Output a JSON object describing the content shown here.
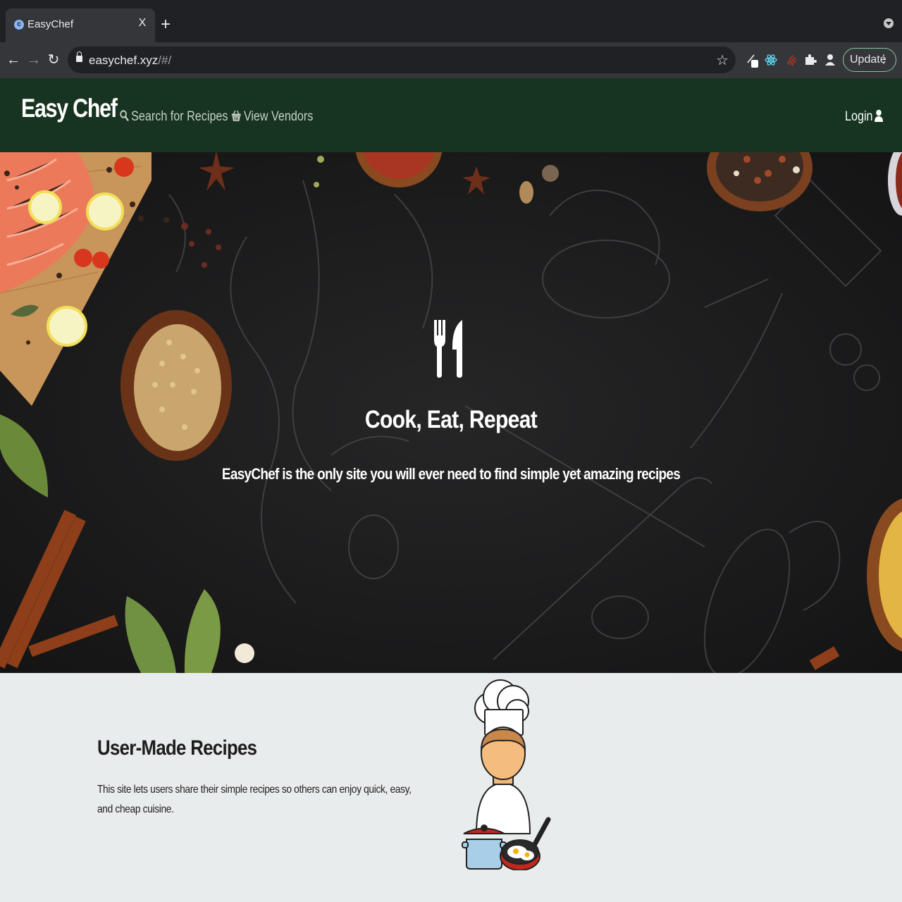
{
  "browser": {
    "tab": {
      "title": "EasyChef",
      "favicon": "c",
      "close_label": "X"
    },
    "new_tab_label": "+",
    "url": {
      "host": "easychef.xyz",
      "path": "/#/"
    },
    "update_label": "Update",
    "icons": [
      "back-icon",
      "forward-icon",
      "reload-icon",
      "lock-icon",
      "star-icon",
      "react-devtools-icon",
      "puzzle-extensions-icon",
      "profile-icon",
      "menu-dots-icon"
    ]
  },
  "navbar": {
    "brand": "Easy Chef",
    "links": [
      {
        "label": "Search for Recipes",
        "icon": "search-icon"
      },
      {
        "label": "View Vendors",
        "icon": "basket-icon"
      }
    ],
    "login_label": "Login",
    "colors": {
      "background": "#163420"
    }
  },
  "hero": {
    "icon": "utensils-icon",
    "title": "Cook, Eat, Repeat",
    "subtitle": "EasyChef is the only site you will ever need to find simple yet amazing recipes"
  },
  "features": {
    "title": "User-Made Recipes",
    "description": "This site lets users share their simple recipes so others can enjoy quick, easy, and cheap cuisine.",
    "illustration": "chef-illustration"
  }
}
